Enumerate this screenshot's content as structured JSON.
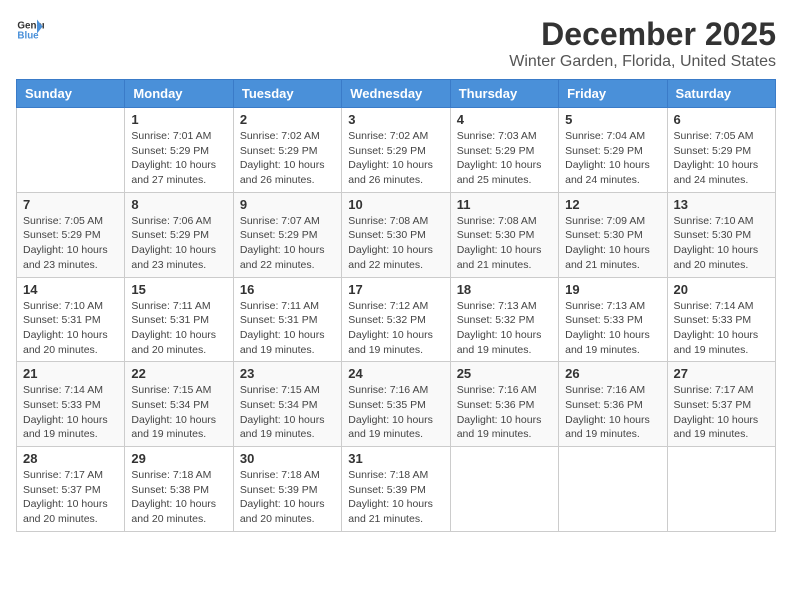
{
  "logo": {
    "text_general": "General",
    "text_blue": "Blue"
  },
  "header": {
    "month_year": "December 2025",
    "location": "Winter Garden, Florida, United States"
  },
  "weekdays": [
    "Sunday",
    "Monday",
    "Tuesday",
    "Wednesday",
    "Thursday",
    "Friday",
    "Saturday"
  ],
  "weeks": [
    [
      {
        "day": "",
        "info": ""
      },
      {
        "day": "1",
        "info": "Sunrise: 7:01 AM\nSunset: 5:29 PM\nDaylight: 10 hours\nand 27 minutes."
      },
      {
        "day": "2",
        "info": "Sunrise: 7:02 AM\nSunset: 5:29 PM\nDaylight: 10 hours\nand 26 minutes."
      },
      {
        "day": "3",
        "info": "Sunrise: 7:02 AM\nSunset: 5:29 PM\nDaylight: 10 hours\nand 26 minutes."
      },
      {
        "day": "4",
        "info": "Sunrise: 7:03 AM\nSunset: 5:29 PM\nDaylight: 10 hours\nand 25 minutes."
      },
      {
        "day": "5",
        "info": "Sunrise: 7:04 AM\nSunset: 5:29 PM\nDaylight: 10 hours\nand 24 minutes."
      },
      {
        "day": "6",
        "info": "Sunrise: 7:05 AM\nSunset: 5:29 PM\nDaylight: 10 hours\nand 24 minutes."
      }
    ],
    [
      {
        "day": "7",
        "info": "Sunrise: 7:05 AM\nSunset: 5:29 PM\nDaylight: 10 hours\nand 23 minutes."
      },
      {
        "day": "8",
        "info": "Sunrise: 7:06 AM\nSunset: 5:29 PM\nDaylight: 10 hours\nand 23 minutes."
      },
      {
        "day": "9",
        "info": "Sunrise: 7:07 AM\nSunset: 5:29 PM\nDaylight: 10 hours\nand 22 minutes."
      },
      {
        "day": "10",
        "info": "Sunrise: 7:08 AM\nSunset: 5:30 PM\nDaylight: 10 hours\nand 22 minutes."
      },
      {
        "day": "11",
        "info": "Sunrise: 7:08 AM\nSunset: 5:30 PM\nDaylight: 10 hours\nand 21 minutes."
      },
      {
        "day": "12",
        "info": "Sunrise: 7:09 AM\nSunset: 5:30 PM\nDaylight: 10 hours\nand 21 minutes."
      },
      {
        "day": "13",
        "info": "Sunrise: 7:10 AM\nSunset: 5:30 PM\nDaylight: 10 hours\nand 20 minutes."
      }
    ],
    [
      {
        "day": "14",
        "info": "Sunrise: 7:10 AM\nSunset: 5:31 PM\nDaylight: 10 hours\nand 20 minutes."
      },
      {
        "day": "15",
        "info": "Sunrise: 7:11 AM\nSunset: 5:31 PM\nDaylight: 10 hours\nand 20 minutes."
      },
      {
        "day": "16",
        "info": "Sunrise: 7:11 AM\nSunset: 5:31 PM\nDaylight: 10 hours\nand 19 minutes."
      },
      {
        "day": "17",
        "info": "Sunrise: 7:12 AM\nSunset: 5:32 PM\nDaylight: 10 hours\nand 19 minutes."
      },
      {
        "day": "18",
        "info": "Sunrise: 7:13 AM\nSunset: 5:32 PM\nDaylight: 10 hours\nand 19 minutes."
      },
      {
        "day": "19",
        "info": "Sunrise: 7:13 AM\nSunset: 5:33 PM\nDaylight: 10 hours\nand 19 minutes."
      },
      {
        "day": "20",
        "info": "Sunrise: 7:14 AM\nSunset: 5:33 PM\nDaylight: 10 hours\nand 19 minutes."
      }
    ],
    [
      {
        "day": "21",
        "info": "Sunrise: 7:14 AM\nSunset: 5:33 PM\nDaylight: 10 hours\nand 19 minutes."
      },
      {
        "day": "22",
        "info": "Sunrise: 7:15 AM\nSunset: 5:34 PM\nDaylight: 10 hours\nand 19 minutes."
      },
      {
        "day": "23",
        "info": "Sunrise: 7:15 AM\nSunset: 5:34 PM\nDaylight: 10 hours\nand 19 minutes."
      },
      {
        "day": "24",
        "info": "Sunrise: 7:16 AM\nSunset: 5:35 PM\nDaylight: 10 hours\nand 19 minutes."
      },
      {
        "day": "25",
        "info": "Sunrise: 7:16 AM\nSunset: 5:36 PM\nDaylight: 10 hours\nand 19 minutes."
      },
      {
        "day": "26",
        "info": "Sunrise: 7:16 AM\nSunset: 5:36 PM\nDaylight: 10 hours\nand 19 minutes."
      },
      {
        "day": "27",
        "info": "Sunrise: 7:17 AM\nSunset: 5:37 PM\nDaylight: 10 hours\nand 19 minutes."
      }
    ],
    [
      {
        "day": "28",
        "info": "Sunrise: 7:17 AM\nSunset: 5:37 PM\nDaylight: 10 hours\nand 20 minutes."
      },
      {
        "day": "29",
        "info": "Sunrise: 7:18 AM\nSunset: 5:38 PM\nDaylight: 10 hours\nand 20 minutes."
      },
      {
        "day": "30",
        "info": "Sunrise: 7:18 AM\nSunset: 5:39 PM\nDaylight: 10 hours\nand 20 minutes."
      },
      {
        "day": "31",
        "info": "Sunrise: 7:18 AM\nSunset: 5:39 PM\nDaylight: 10 hours\nand 21 minutes."
      },
      {
        "day": "",
        "info": ""
      },
      {
        "day": "",
        "info": ""
      },
      {
        "day": "",
        "info": ""
      }
    ]
  ]
}
